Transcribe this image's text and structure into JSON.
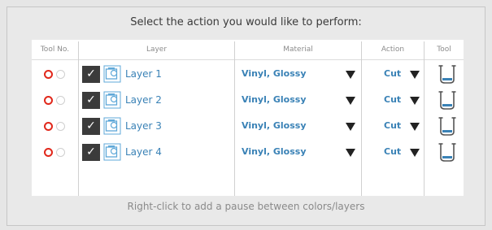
{
  "dialog": {
    "title": "Select the action you would like to perform:",
    "footer": "Right-click to add a pause between colors/layers"
  },
  "table": {
    "headers": {
      "tool_no": "Tool No.",
      "layer": "Layer",
      "material": "Material",
      "action": "Action",
      "tool": "Tool"
    },
    "rows": [
      {
        "layer": "Layer 1",
        "material": "Vinyl, Glossy",
        "action": "Cut",
        "checked": true,
        "tool_selected": 1
      },
      {
        "layer": "Layer 2",
        "material": "Vinyl, Glossy",
        "action": "Cut",
        "checked": true,
        "tool_selected": 1
      },
      {
        "layer": "Layer 3",
        "material": "Vinyl, Glossy",
        "action": "Cut",
        "checked": true,
        "tool_selected": 1
      },
      {
        "layer": "Layer 4",
        "material": "Vinyl, Glossy",
        "action": "Cut",
        "checked": true,
        "tool_selected": 1
      }
    ]
  },
  "icons": {
    "checkmark": "✓",
    "layer": "layer-icon",
    "dropdown": "dropdown-arrow-icon",
    "tool": "blade-holder-icon"
  },
  "colors": {
    "accent_blue": "#3a82b6",
    "radio_selected": "#e1281b",
    "radio_unselected": "#cfcfcf"
  }
}
